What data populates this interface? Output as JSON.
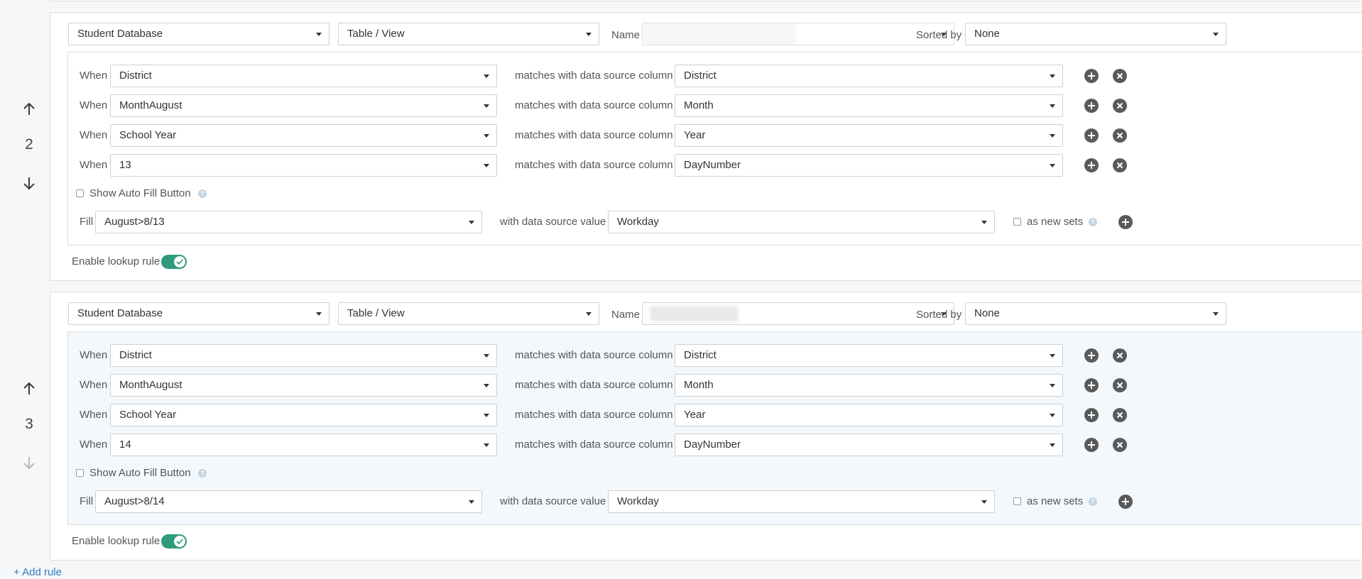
{
  "rules": [
    {
      "number": "2",
      "source": {
        "database": "Student Database",
        "object_type": "Table / View",
        "name_label": "Name",
        "sorted_by_label": "Sorted by",
        "sorted_by": "None"
      },
      "conditions": [
        {
          "when_label": "When",
          "field": "District",
          "match_label": "matches with data source column",
          "column": "District"
        },
        {
          "when_label": "When",
          "field": "MonthAugust",
          "match_label": "matches with data source column",
          "column": "Month"
        },
        {
          "when_label": "When",
          "field": "School Year",
          "match_label": "matches with data source column",
          "column": "Year"
        },
        {
          "when_label": "When",
          "field": "13",
          "match_label": "matches with data source column",
          "column": "DayNumber"
        }
      ],
      "show_auto_fill_label": "Show Auto Fill Button",
      "fill": {
        "fill_label": "Fill",
        "target": "August>8/13",
        "value_label": "with data source value",
        "value": "Workday",
        "new_sets_label": "as new sets"
      },
      "enable_label": "Enable lookup rule"
    },
    {
      "number": "3",
      "source": {
        "database": "Student Database",
        "object_type": "Table / View",
        "name_label": "Name",
        "sorted_by_label": "Sorted by",
        "sorted_by": "None"
      },
      "conditions": [
        {
          "when_label": "When",
          "field": "District",
          "match_label": "matches with data source column",
          "column": "District"
        },
        {
          "when_label": "When",
          "field": "MonthAugust",
          "match_label": "matches with data source column",
          "column": "Month"
        },
        {
          "when_label": "When",
          "field": "School Year",
          "match_label": "matches with data source column",
          "column": "Year"
        },
        {
          "when_label": "When",
          "field": "14",
          "match_label": "matches with data source column",
          "column": "DayNumber"
        }
      ],
      "show_auto_fill_label": "Show Auto Fill Button",
      "fill": {
        "fill_label": "Fill",
        "target": "August>8/14",
        "value_label": "with data source value",
        "value": "Workday",
        "new_sets_label": "as new sets"
      },
      "enable_label": "Enable lookup rule"
    }
  ],
  "add_rule_label": "+ Add rule",
  "colors": {
    "toggle_on": "#2f9a7c",
    "link": "#2d7cc1",
    "icon_button": "#5a5a5a",
    "active_panel": "#f3f8fc"
  }
}
